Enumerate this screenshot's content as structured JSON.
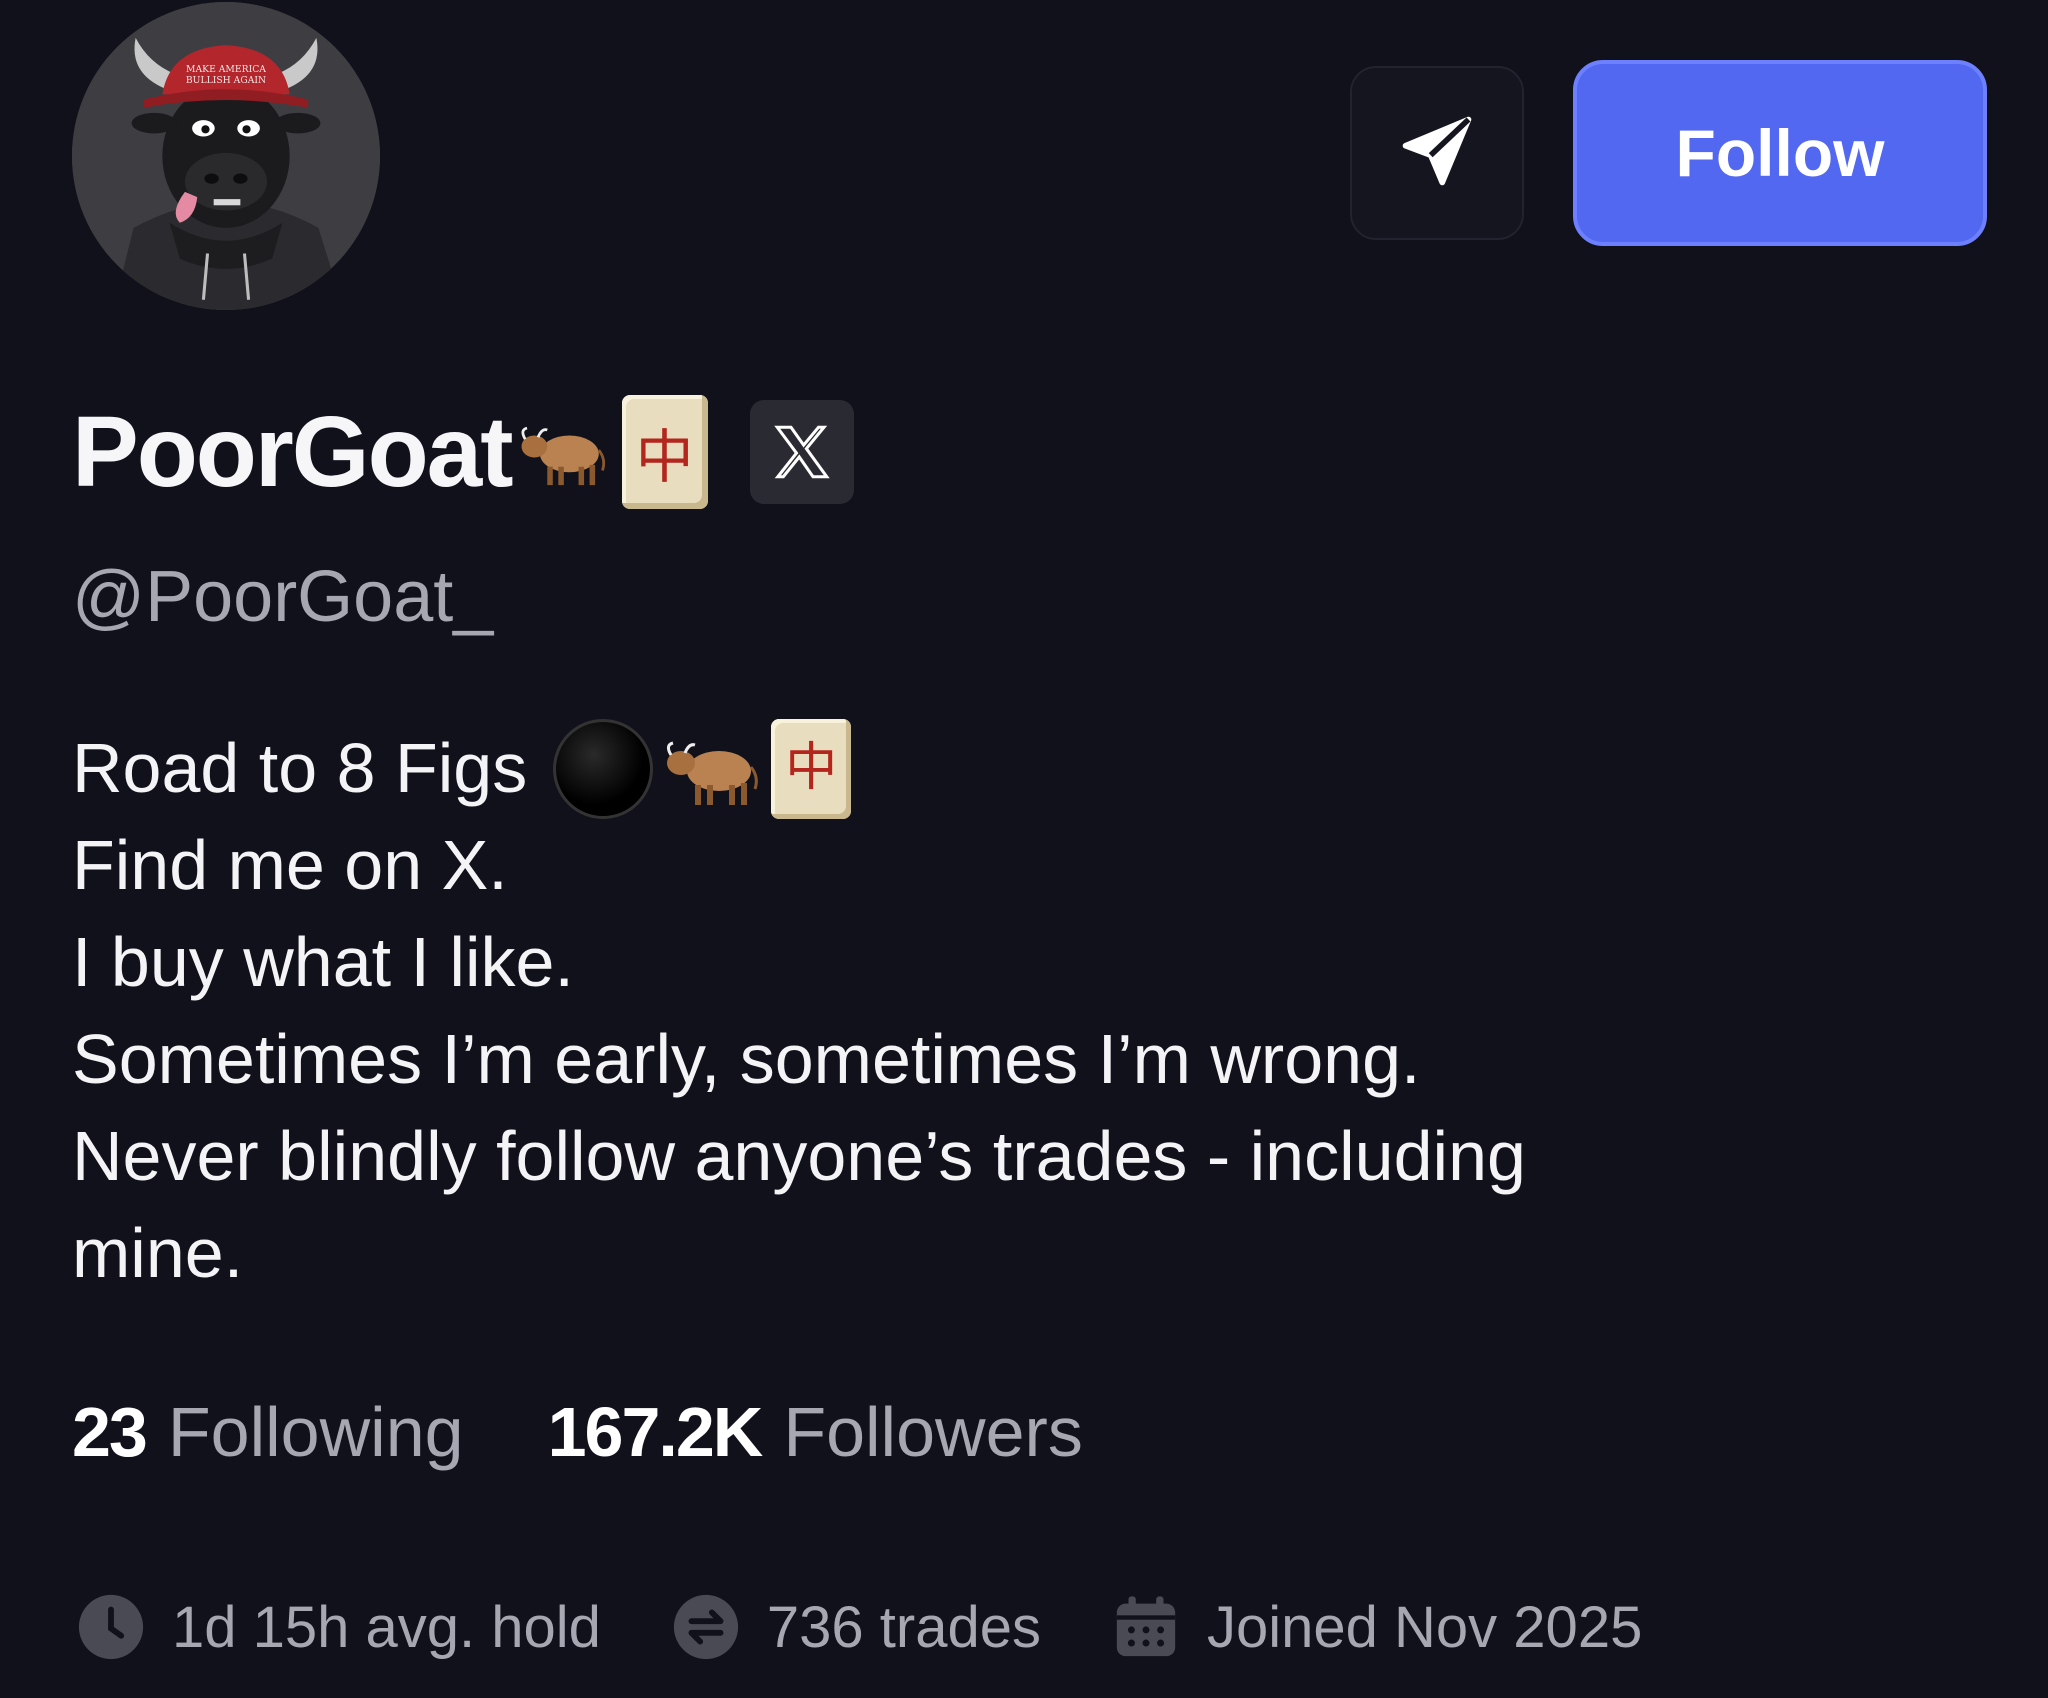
{
  "profile": {
    "display_name": "PoorGoat",
    "handle": "@PoorGoat_",
    "name_emojis": [
      "ox-icon",
      "mahjong-red-dragon-icon"
    ],
    "mahjong_char": "中",
    "x_link_label": "𝕏",
    "avatar_hat_text": "MAKE AMERICA BULLISH AGAIN"
  },
  "actions": {
    "share_icon": "send-icon",
    "follow_label": "Follow"
  },
  "bio": {
    "line1": "Road to 8 Figs",
    "line1_emojis": [
      "black-circle-icon",
      "ox-icon",
      "mahjong-red-dragon-icon"
    ],
    "line2": "Find me on X.",
    "line3": "I buy what I like.",
    "line4": "Sometimes I’m early, sometimes I’m wrong.",
    "line5": "Never blindly follow anyone’s trades - including",
    "line6": "mine."
  },
  "stats": {
    "following_count": "23",
    "following_label": "Following",
    "followers_count": "167.2K",
    "followers_label": "Followers"
  },
  "meta": {
    "avg_hold": "1d 15h avg. hold",
    "trades": "736 trades",
    "joined": "Joined Nov 2025"
  },
  "colors": {
    "background": "#11111b",
    "accent": "#5368f0",
    "muted_text": "#a7a7b2"
  }
}
